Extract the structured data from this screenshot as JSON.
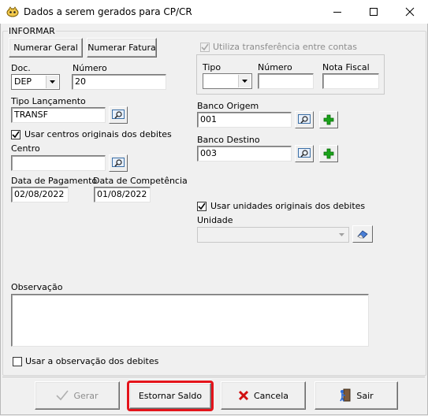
{
  "window": {
    "title": "Dados a serem gerados para CP/CR"
  },
  "group": {
    "legend": "INFORMAR"
  },
  "buttons": {
    "numerar_geral": "Numerar Geral",
    "numerar_fatura": "Numerar Fatura"
  },
  "doc": {
    "label": "Doc.",
    "value": "DEP"
  },
  "numero": {
    "label": "Número",
    "value": "20"
  },
  "tipo_lancamento": {
    "label": "Tipo Lançamento",
    "value": "TRANSF"
  },
  "usar_centros": {
    "label": "Usar centros originais dos debites",
    "checked": true
  },
  "centro": {
    "label": "Centro",
    "value": ""
  },
  "data_pagamento": {
    "label": "Data de Pagamento",
    "value": "02/08/2022"
  },
  "data_competencia": {
    "label": "Data de Competência",
    "value": "01/08/2022"
  },
  "transferencia": {
    "label": "Utiliza transferência entre contas",
    "checked": true,
    "tipo_label": "Tipo",
    "tipo_value": "",
    "numero_label": "Número",
    "numero_value": "",
    "nota_fiscal_label": "Nota Fiscal",
    "nota_fiscal_value": ""
  },
  "banco_origem": {
    "label": "Banco Origem",
    "value": "001"
  },
  "banco_destino": {
    "label": "Banco Destino",
    "value": "003"
  },
  "usar_unidades": {
    "label": "Usar unidades originais dos debites",
    "checked": true
  },
  "unidade": {
    "label": "Unidade",
    "value": ""
  },
  "observacao": {
    "label": "Observação",
    "value": ""
  },
  "usar_observacao": {
    "label": "Usar a observação dos debites",
    "checked": false
  },
  "footer": {
    "gerar": "Gerar",
    "estornar_saldo": "Estornar Saldo",
    "cancela": "Cancela",
    "sair": "Sair"
  },
  "colors": {
    "highlight": "#e4141b",
    "plus_green": "#1aa31a",
    "cancel_red": "#d01010"
  },
  "icons": [
    "app-icon",
    "minimize-icon",
    "maximize-icon",
    "close-icon",
    "search-icon",
    "plus-icon",
    "eraser-icon",
    "check-icon",
    "x-icon",
    "exit-icon"
  ]
}
